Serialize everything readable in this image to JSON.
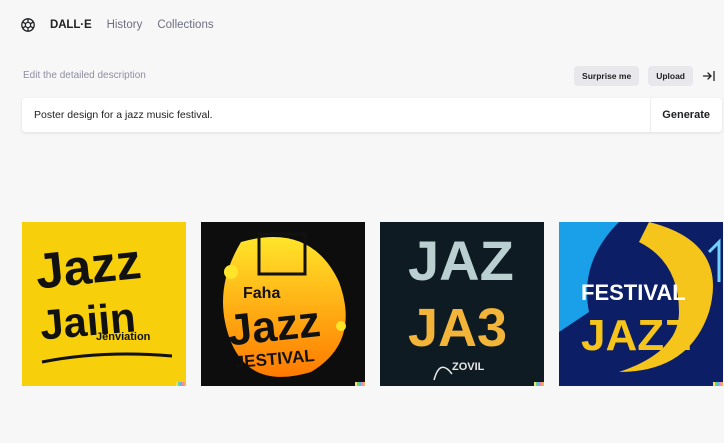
{
  "nav": {
    "brand": "DALL·E",
    "links": [
      "History",
      "Collections"
    ]
  },
  "prompt": {
    "label": "Edit the detailed description",
    "surprise_label": "Surprise me",
    "upload_label": "Upload",
    "value": "Poster design for a jazz music festival.",
    "generate_label": "Generate"
  },
  "results": [
    {
      "alt": "Yellow jazz poster with black brush lettering",
      "bg": "#f7cf0a",
      "lines": [
        "Jazz",
        "Jaiin",
        "Jenviation"
      ]
    },
    {
      "alt": "Black jazz festival poster with orange gradient shape",
      "bg": "#0d0d0d",
      "lines": [
        "Faha",
        "Jazz",
        "JESTIVAL"
      ]
    },
    {
      "alt": "Dark teal poster with large JAZ lettering",
      "bg": "#0f1b22",
      "lines": [
        "JAZ",
        "JA3",
        "ZOVIL"
      ]
    },
    {
      "alt": "Navy festival poster with yellow and blue shapes",
      "bg": "#0b1e66",
      "lines": [
        "FESTIVAL",
        "JAZZ"
      ]
    }
  ],
  "colors": {
    "page_bg": "#f7f7f8",
    "text_primary": "#202123",
    "text_muted": "#8e8ea0",
    "pill_bg": "#e8e8ec"
  },
  "icons": {
    "logo": "openai-logo-icon",
    "collapse": "arrow-to-right-bar-icon"
  }
}
